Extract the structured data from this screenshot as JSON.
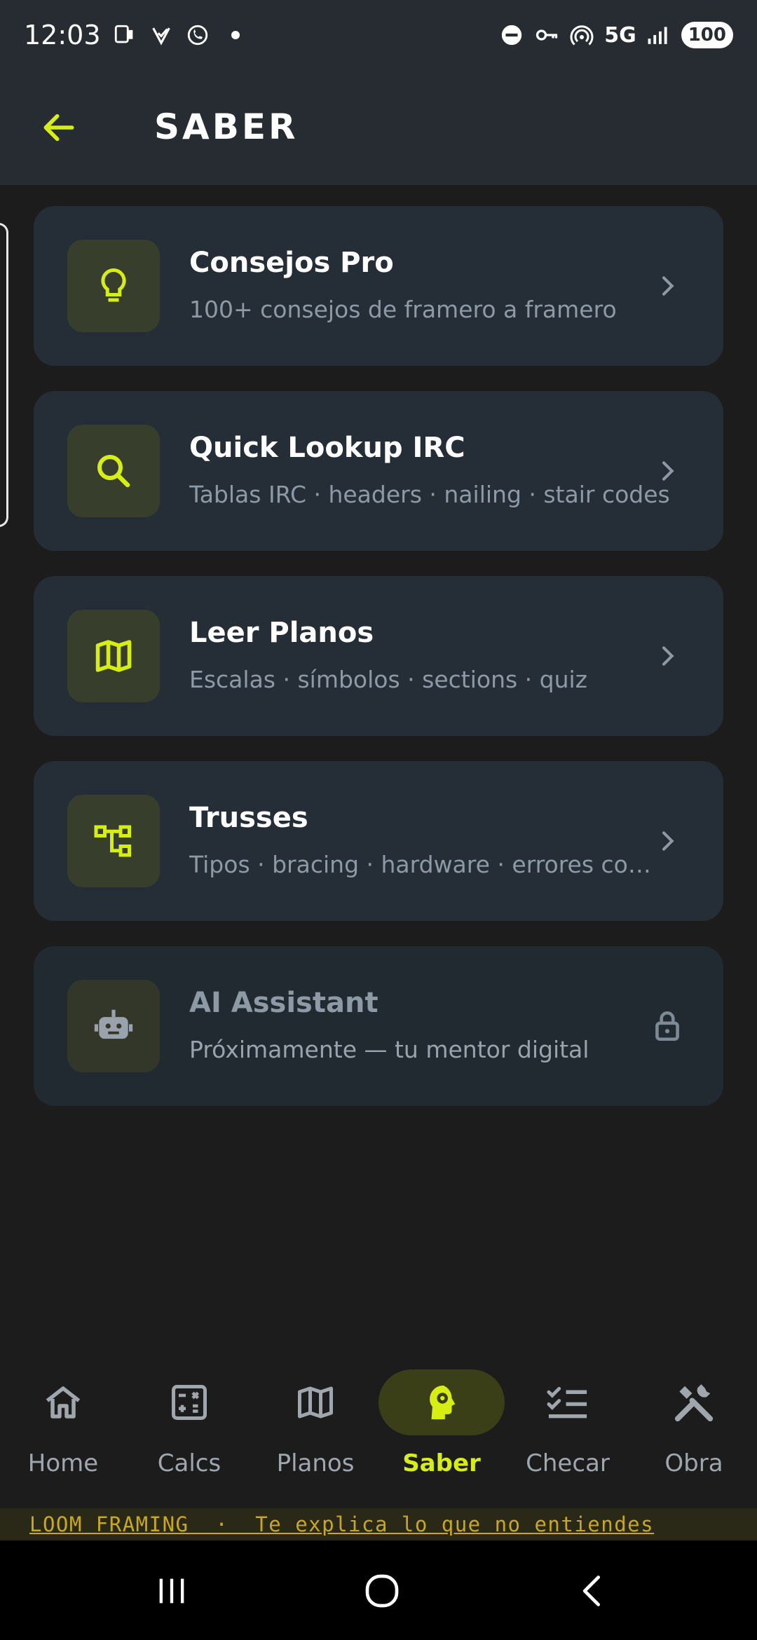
{
  "status_bar": {
    "time": "12:03",
    "network": "5G",
    "battery": "100"
  },
  "header": {
    "title": "SABER",
    "back_icon": "arrow-left-icon"
  },
  "cards": [
    {
      "title": "Consejos Pro",
      "subtitle": "100+ consejos de framero a framero",
      "icon": "lightbulb-icon",
      "locked": false
    },
    {
      "title": "Quick Lookup IRC",
      "subtitle": "Tablas IRC · headers · nailing · stair codes",
      "icon": "search-icon",
      "locked": false
    },
    {
      "title": "Leer Planos",
      "subtitle": "Escalas · símbolos · sections · quiz",
      "icon": "map-icon",
      "locked": false
    },
    {
      "title": "Trusses",
      "subtitle": "Tipos · bracing · hardware · errores comunes",
      "icon": "tree-structure-icon",
      "locked": false
    },
    {
      "title": "AI Assistant",
      "subtitle": "Próximamente — tu mentor digital",
      "icon": "robot-icon",
      "locked": true
    }
  ],
  "bottom_nav": {
    "items": [
      {
        "label": "Home",
        "icon": "home-icon",
        "active": false
      },
      {
        "label": "Calcs",
        "icon": "calculator-icon",
        "active": false
      },
      {
        "label": "Planos",
        "icon": "map-icon",
        "active": false
      },
      {
        "label": "Saber",
        "icon": "brain-gear-icon",
        "active": true
      },
      {
        "label": "Checar",
        "icon": "checklist-icon",
        "active": false
      },
      {
        "label": "Obra",
        "icon": "tools-icon",
        "active": false
      }
    ]
  },
  "ticker": {
    "text": "LOOM FRAMING  ·  Te explica lo que no entiendes"
  },
  "colors": {
    "accent": "#d6ee12",
    "card_bg": "#252e37",
    "icon_tile_bg": "#373f2c",
    "header_bg": "#262c31",
    "muted_text": "#8d9aa6"
  }
}
